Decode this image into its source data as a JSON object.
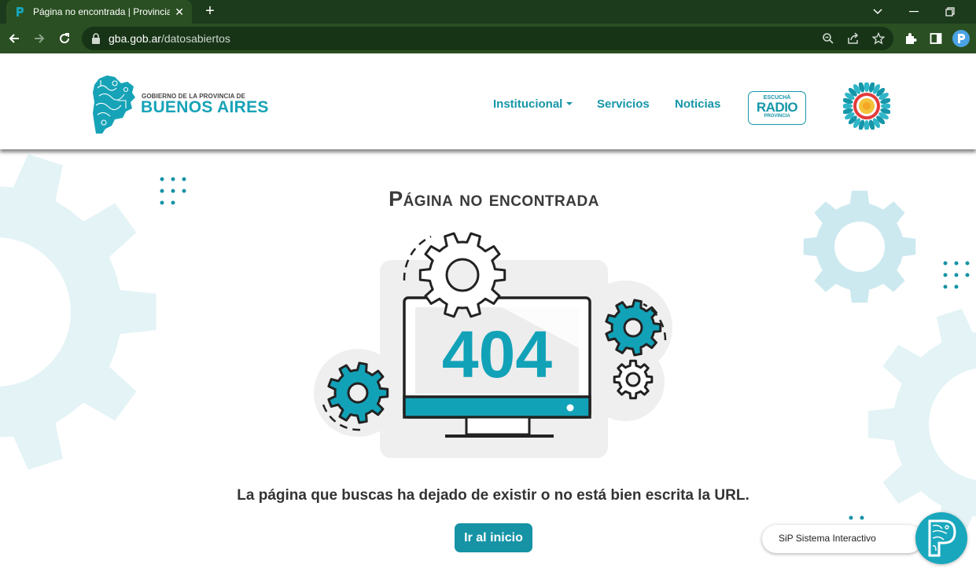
{
  "browser": {
    "tab_title": "Página no encontrada | Provincia de Buenos Aires",
    "url_host": "gba.gob.ar",
    "url_path": "/datosabiertos"
  },
  "header": {
    "logo_small": "GOBIERNO DE LA PROVINCIA DE",
    "logo_big": "BUENOS AIRES",
    "nav": [
      {
        "label": "Institucional",
        "dropdown": true
      },
      {
        "label": "Servicios"
      },
      {
        "label": "Noticias"
      }
    ],
    "radio": {
      "line1": "ESCUCHÁ",
      "line2": "RADIO",
      "line3": "PROVINCIA"
    }
  },
  "main": {
    "title": "Página no encontrada",
    "error_code": "404",
    "message": "La página que buscas ha dejado de existir o no está bien escrita la URL.",
    "home_button": "Ir al inicio"
  },
  "widget": {
    "label": "SiP Sistema Interactivo"
  },
  "colors": {
    "brand": "#1596a8",
    "accent": "#12a2b8",
    "chrome_dark": "#1c3a1c",
    "chrome": "#2a4f22",
    "deco_light": "#e3f3f6"
  },
  "icons": [
    "back-icon",
    "forward-icon",
    "reload-icon",
    "lock-icon",
    "zoom-icon",
    "share-icon",
    "star-icon",
    "extensions-icon",
    "sidepanel-icon",
    "profile-icon",
    "gear-icon",
    "monitor-icon",
    "emblem-icon",
    "map-logo-icon"
  ]
}
